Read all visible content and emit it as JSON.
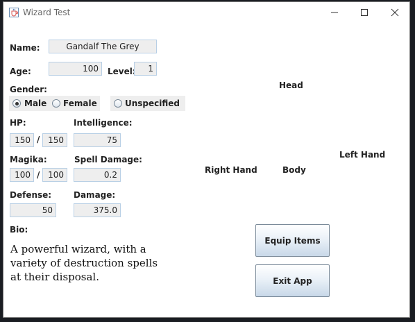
{
  "window": {
    "title": "Wizard Test",
    "icon": "java-cup-icon",
    "controls": [
      "minimize-icon",
      "maximize-icon",
      "close-icon"
    ]
  },
  "form": {
    "name_label": "Name:",
    "name_value": "Gandalf The Grey",
    "age_label": "Age:",
    "age_value": "100",
    "level_label": "Level:",
    "level_value": "1",
    "gender_label": "Gender:",
    "gender_options": [
      "Male",
      "Female",
      "Unspecified"
    ],
    "gender_selected": "Male",
    "hp_label": "HP:",
    "hp_current": "150",
    "hp_max": "150",
    "intelligence_label": "Intelligence:",
    "intelligence_value": "75",
    "magika_label": "Magika:",
    "magika_current": "100",
    "magika_max": "100",
    "spell_damage_label": "Spell Damage:",
    "spell_damage_value": "0.2",
    "defense_label": "Defense:",
    "defense_value": "50",
    "damage_label": "Damage:",
    "damage_value": "375.0",
    "separator": "/",
    "bio_label": "Bio:",
    "bio_text": "A powerful wizard, with a variety of destruction spells at their disposal."
  },
  "equipment": {
    "head": "Head",
    "left_hand": "Left Hand",
    "right_hand": "Right Hand",
    "body": "Body"
  },
  "buttons": {
    "equip_items": "Equip Items",
    "exit_app": "Exit App"
  }
}
